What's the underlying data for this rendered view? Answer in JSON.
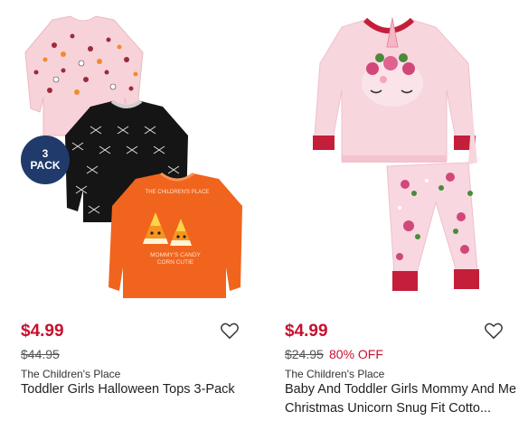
{
  "products": [
    {
      "price": "$4.99",
      "was_price": "$44.95",
      "discount": "",
      "brand": "The Children's Place",
      "title": "Toddler Girls Halloween Tops 3-Pack",
      "badge_number": "3",
      "badge_text": "PACK",
      "shirt_print": "MOMMY'S CANDY CORN CUTIE",
      "wishlist_icon": "heart-outline-icon"
    },
    {
      "price": "$4.99",
      "was_price": "$24.95",
      "discount": "80% OFF",
      "brand": "The Children's Place",
      "title": "Baby And Toddler Girls Mommy And Me Christmas Unicorn Snug Fit Cotto...",
      "wishlist_icon": "heart-outline-icon"
    }
  ],
  "colors": {
    "price": "#c8102e",
    "badge": "#1f3a6b"
  }
}
